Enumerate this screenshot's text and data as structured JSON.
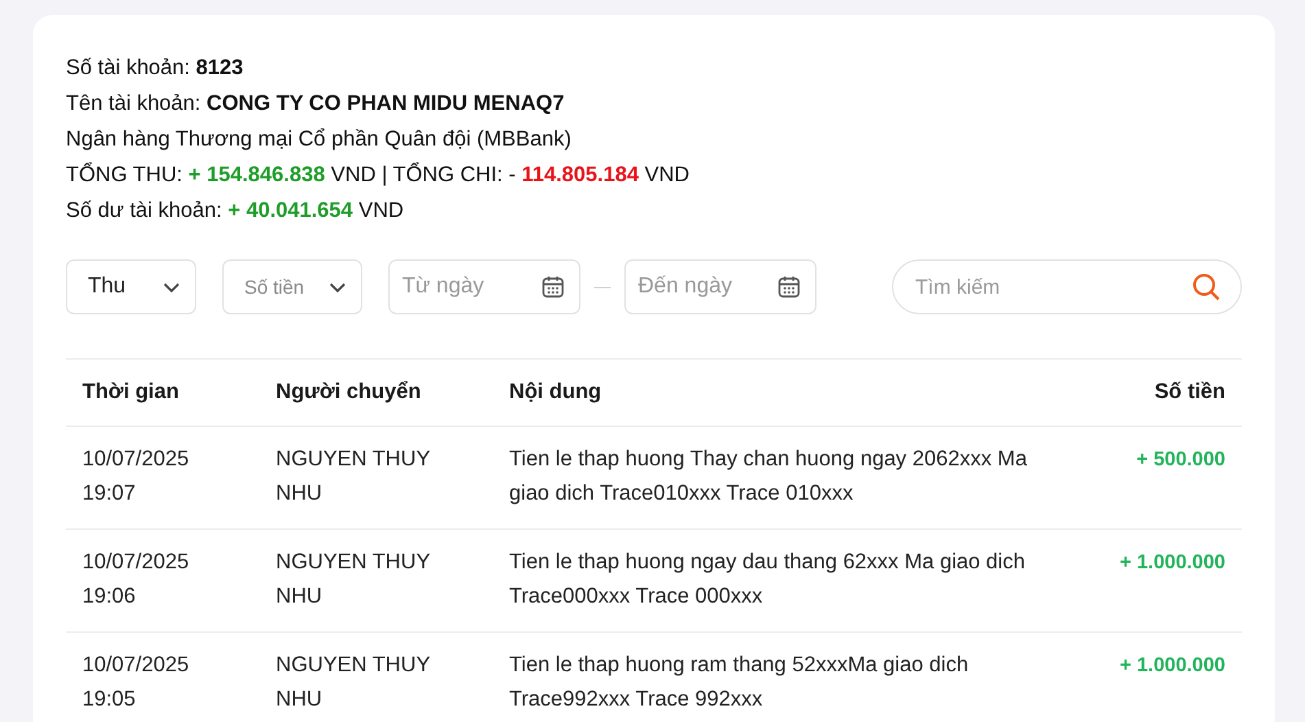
{
  "account_info": [
    {
      "segments": [
        {
          "text": "Số tài khoản:",
          "kind": "plain"
        },
        {
          "text": "8123",
          "kind": "bold"
        }
      ]
    },
    {
      "segments": [
        {
          "text": "Tên tài khoản:",
          "kind": "plain"
        },
        {
          "text": "CONG TY CO PHAN MIDU MENAQ7",
          "kind": "bold"
        }
      ]
    },
    {
      "segments": [
        {
          "text": "Ngân hàng Thương mại Cổ phần Quân đội (MBBank)",
          "kind": "plain"
        }
      ]
    },
    {
      "segments": [
        {
          "text": "TỔNG THU:",
          "kind": "plain"
        },
        {
          "text": "+ 154.846.838",
          "kind": "income"
        },
        {
          "text": "VND | TỔNG CHI: -",
          "kind": "plain"
        },
        {
          "text": "114.805.184",
          "kind": "expense"
        },
        {
          "text": "VND",
          "kind": "plain"
        }
      ]
    },
    {
      "segments": [
        {
          "text": "Số dư tài khoản:",
          "kind": "plain"
        },
        {
          "text": "+ 40.041.654",
          "kind": "income"
        },
        {
          "text": "VND",
          "kind": "plain"
        }
      ]
    }
  ],
  "filters": {
    "type_select": {
      "value": "Thu"
    },
    "amount_select": {
      "placeholder": "Số tiền"
    },
    "from_date": {
      "placeholder": "Từ ngày"
    },
    "to_date": {
      "placeholder": "Đến ngày"
    },
    "search": {
      "placeholder": "Tìm kiếm"
    }
  },
  "table": {
    "columns": [
      "Thời gian",
      "Người chuyển",
      "Nội dung",
      "Số tiền"
    ],
    "rows": [
      {
        "time": "10/07/2025 19:07",
        "sender": "NGUYEN THUY NHU",
        "content": "Tien le thap huong Thay chan huong ngay 2062xxx Ma giao dich Trace010xxx Trace 010xxx",
        "amount": "+ 500.000"
      },
      {
        "time": "10/07/2025 19:06",
        "sender": "NGUYEN THUY NHU",
        "content": "Tien le thap huong ngay dau thang 62xxx Ma giao dich Trace000xxx Trace 000xxx",
        "amount": "+ 1.000.000"
      },
      {
        "time": "10/07/2025 19:05",
        "sender": "NGUYEN THUY NHU",
        "content": "Tien le thap huong ram thang 52xxxMa giao dich Trace992xxx Trace 992xxx",
        "amount": "+ 1.000.000"
      }
    ]
  }
}
